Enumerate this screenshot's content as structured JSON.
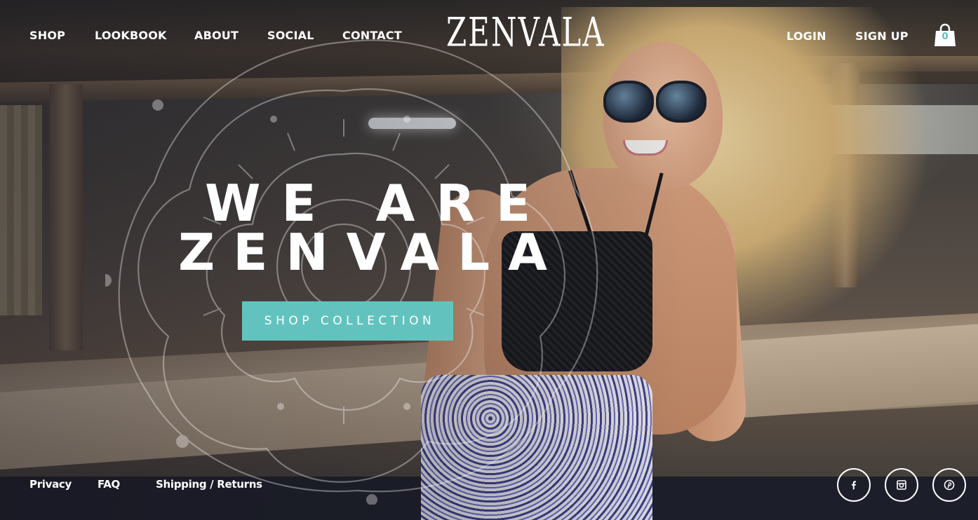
{
  "brand": {
    "logo_text": "ZENVALA"
  },
  "nav": {
    "left": [
      "SHOP",
      "LOOKBOOK",
      "ABOUT",
      "SOCIAL",
      "CONTACT"
    ],
    "login": "LOGIN",
    "signup": "SIGN UP",
    "cart_count": "0"
  },
  "hero": {
    "line1": "WE ARE",
    "line2": "ZENVALA",
    "cta_label": "SHOP COLLECTION"
  },
  "footer": {
    "links": [
      "Privacy",
      "FAQ",
      "Shipping / Returns"
    ],
    "social_icons": [
      "facebook-icon",
      "instagram-icon",
      "pinterest-icon"
    ]
  },
  "colors": {
    "accent": "#62c3be",
    "text": "#ffffff"
  }
}
